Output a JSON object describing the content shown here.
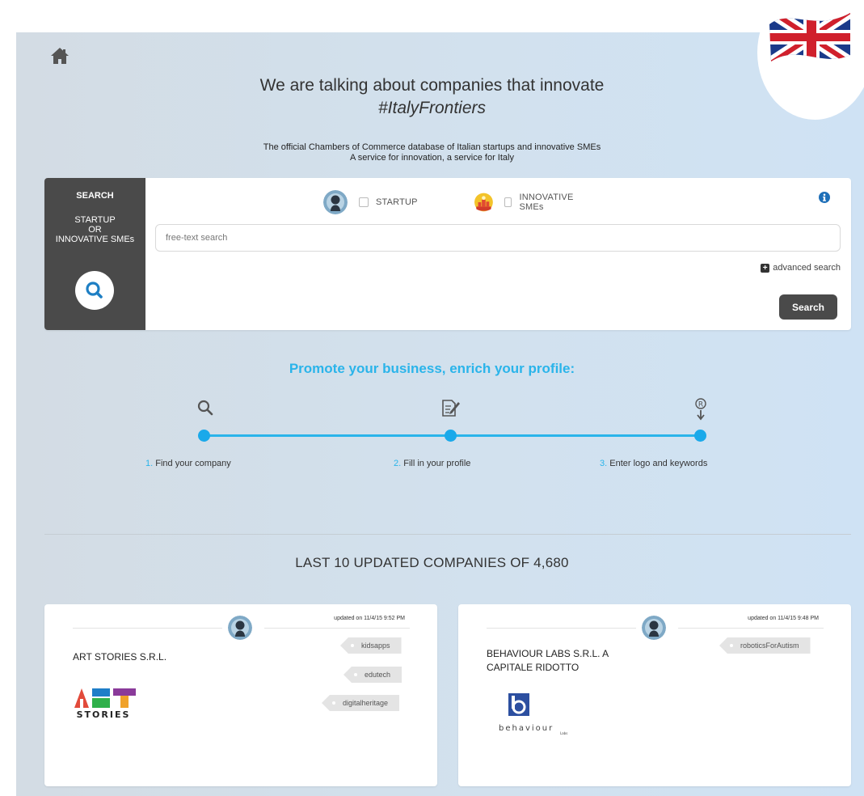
{
  "header": {
    "headline": "We are talking about companies that innovate",
    "hashtag": "#ItalyFrontiers",
    "subtitle_line1": "The official Chambers of Commerce database of Italian startups and innovative SMEs",
    "subtitle_line2": "A service for innovation, a service for Italy",
    "home_icon": "home-icon",
    "language_flag": "uk-flag"
  },
  "search": {
    "side_title": "SEARCH",
    "side_line1": "STARTUP",
    "side_line2": "OR",
    "side_line3": "INNOVATIVE SMEs",
    "type_startup": "STARTUP",
    "type_sme": "INNOVATIVE SMEs",
    "placeholder": "free-text search",
    "advanced_label": "advanced search",
    "button_label": "Search"
  },
  "promo": {
    "title": "Promote your business, enrich your profile:",
    "steps": [
      {
        "num": "1.",
        "label": "Find your company",
        "icon": "search-icon"
      },
      {
        "num": "2.",
        "label": "Fill in your profile",
        "icon": "edit-icon"
      },
      {
        "num": "3.",
        "label": "Enter logo and keywords",
        "icon": "registered-download-icon"
      }
    ]
  },
  "companies": {
    "title": "LAST 10 UPDATED COMPANIES OF 4,680",
    "cards": [
      {
        "updated": "updated on 11/4/15 9:52 PM",
        "name": "ART STORIES S.R.L.",
        "tags": [
          "kidsapps",
          "edutech",
          "digitalheritage"
        ],
        "logo_letters": "ART",
        "logo_sub": "STORIES"
      },
      {
        "updated": "updated on 11/4/15 9:48 PM",
        "name_line1": "BEHAVIOUR LABS S.R.L. A",
        "name_line2": "CAPITALE RIDOTTO",
        "tags": [
          "roboticsForAutism"
        ],
        "logo_word": "behaviour",
        "logo_sub": "Labs"
      }
    ]
  },
  "colors": {
    "accent": "#2ab4ea",
    "dark_panel": "#4a4a4a"
  }
}
